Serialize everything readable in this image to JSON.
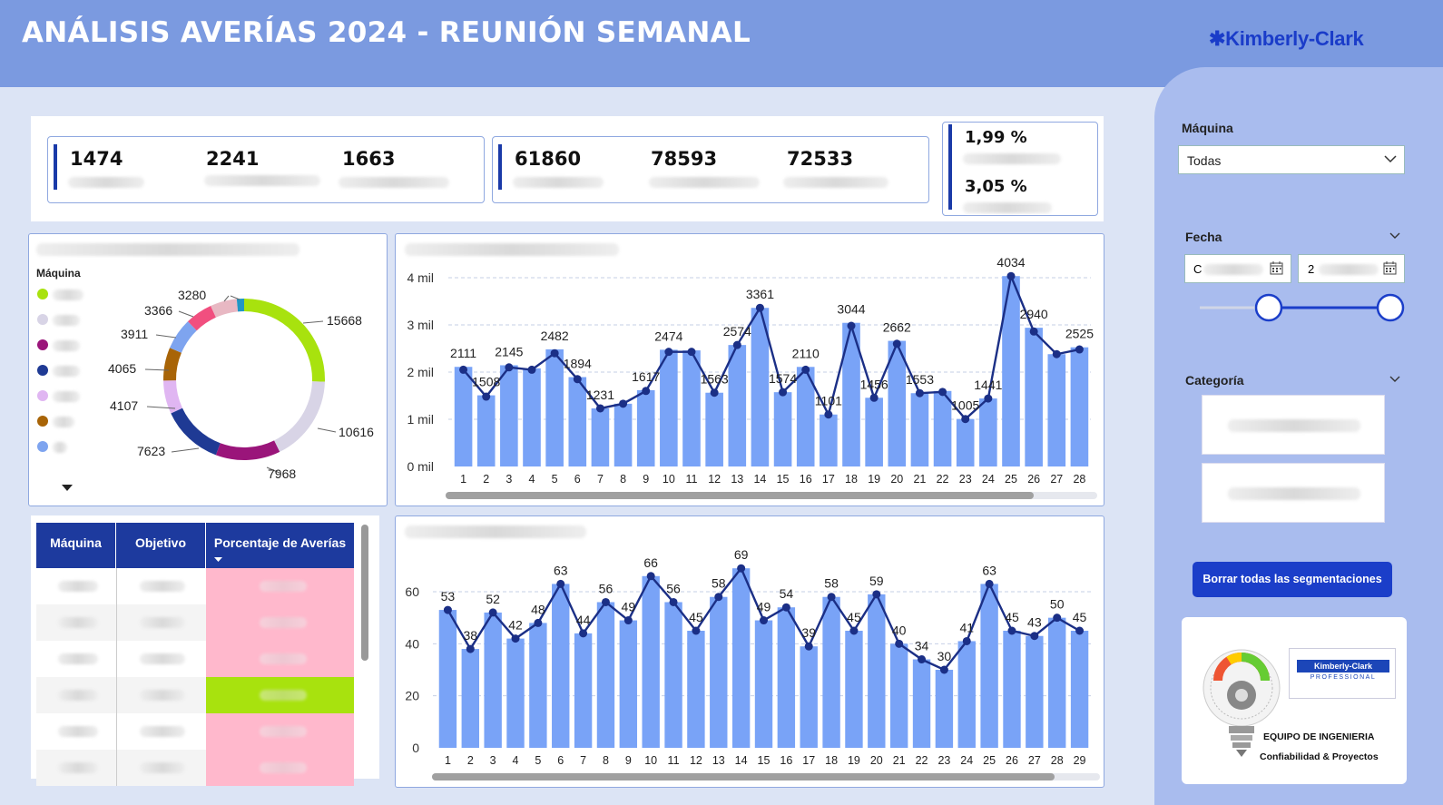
{
  "header": {
    "title": "ANÁLISIS AVERÍAS 2024 - REUNIÓN SEMANAL",
    "brand": "✱Kimberly-Clark"
  },
  "kpis": {
    "group1": [
      "1474",
      "2241",
      "1663"
    ],
    "group2": [
      "61860",
      "78593",
      "72533"
    ],
    "pct1": "1,99 %",
    "pct2": "3,05 %"
  },
  "donut": {
    "legend_title": "Máquina",
    "colors": [
      "#a8e20e",
      "#d8d4e6",
      "#9a157a",
      "#1f3a94",
      "#e0b6f2",
      "#a86407",
      "#7ea4ef",
      "#f14f7f",
      "#e8b8c3",
      "#2196c4"
    ],
    "labels": [
      "15668",
      "10616",
      "7968",
      "7623",
      "4107",
      "4065",
      "3911",
      "3366",
      "3280"
    ]
  },
  "table": {
    "headers": [
      "Máquina",
      "Objetivo",
      "Porcentaje de Averías"
    ],
    "row_colors": [
      "#ffb8cc",
      "#ffb8cc",
      "#ffb8cc",
      "#a8e20e",
      "#ffb8cc",
      "#ffb8cc"
    ]
  },
  "sidebar": {
    "maquina_label": "Máquina",
    "maquina_value": "Todas",
    "fecha_label": "Fecha",
    "date_start": "C",
    "date_end": "2",
    "categoria_label": "Categoría",
    "clear_button": "Borrar todas las segmentaciones",
    "logo_text1": "EQUIPO DE INGENIERIA",
    "logo_text2": "Confiabilidad & Proyectos",
    "logo_brand": "Kimberly-Clark",
    "logo_sub": "PROFESSIONAL"
  },
  "chart_data": [
    {
      "type": "bar",
      "title": "",
      "x": [
        1,
        2,
        3,
        4,
        5,
        6,
        7,
        8,
        9,
        10,
        11,
        12,
        13,
        14,
        15,
        16,
        17,
        18,
        19,
        20,
        21,
        22,
        23,
        24,
        25,
        26,
        27,
        28
      ],
      "bars": [
        2111,
        1508,
        2145,
        2080,
        2482,
        1894,
        1231,
        1330,
        1617,
        2474,
        2460,
        1563,
        2574,
        3361,
        1574,
        2110,
        1101,
        3044,
        1456,
        2662,
        1553,
        1600,
        1005,
        1441,
        4034,
        2940,
        2380,
        2525
      ],
      "line": [
        2050,
        1480,
        2100,
        2050,
        2400,
        1850,
        1231,
        1330,
        1600,
        2430,
        2430,
        1563,
        2574,
        3361,
        1574,
        2050,
        1101,
        2980,
        1456,
        2600,
        1553,
        1580,
        1005,
        1441,
        4034,
        2860,
        2380,
        2480
      ],
      "labels": {
        "1": "2111",
        "2": "1508",
        "3": "2145",
        "5": "2482",
        "6": "1894",
        "7": "1231",
        "9": "1617",
        "10": "2474",
        "12": "1563",
        "13": "2574",
        "14": "3361",
        "15": "1574",
        "16": "2110",
        "17": "1101",
        "18": "3044",
        "19": "1456",
        "20": "2662",
        "21": "1553",
        "23": "1005",
        "24": "1441",
        "25": "4034",
        "26": "2940",
        "28": "2525"
      },
      "y_ticks": [
        "0 mil",
        "1 mil",
        "2 mil",
        "3 mil",
        "4 mil"
      ],
      "ylim": [
        0,
        4000
      ]
    },
    {
      "type": "bar",
      "title": "",
      "x": [
        1,
        2,
        3,
        4,
        5,
        6,
        7,
        8,
        9,
        10,
        11,
        12,
        13,
        14,
        15,
        16,
        17,
        18,
        19,
        20,
        21,
        22,
        23,
        24,
        25,
        26,
        27,
        28,
        29
      ],
      "bars": [
        53,
        38,
        52,
        42,
        48,
        63,
        44,
        56,
        49,
        66,
        56,
        45,
        58,
        69,
        49,
        54,
        39,
        58,
        45,
        59,
        40,
        34,
        30,
        41,
        63,
        45,
        43,
        50,
        45
      ],
      "line": [
        53,
        38,
        52,
        42,
        48,
        63,
        44,
        56,
        49,
        66,
        56,
        45,
        58,
        69,
        49,
        54,
        39,
        58,
        45,
        59,
        40,
        34,
        30,
        41,
        63,
        45,
        43,
        50,
        45
      ],
      "y_ticks": [
        "0",
        "20",
        "40",
        "60"
      ],
      "ylim": [
        0,
        75
      ]
    }
  ]
}
